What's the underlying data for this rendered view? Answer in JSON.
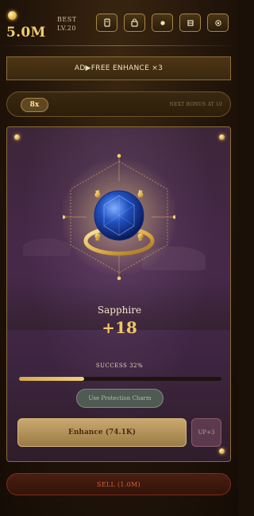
{
  "header": {
    "gold": "5.0M",
    "best_label": "BEST",
    "best_level": "LV.20",
    "toolbar_icons": [
      "card-icon",
      "lock-icon",
      "dot-icon",
      "grid-icon",
      "target-icon"
    ]
  },
  "ad_banner": {
    "label": "AD▶FREE ENHANCE ×3"
  },
  "multiplier": {
    "value": "8x",
    "next_bonus": "NEXT BONUS AT 10"
  },
  "item": {
    "name": "Sapphire",
    "level": "+18",
    "gem_color": "#1f4fb8",
    "setting_color": "#e0b24a"
  },
  "success": {
    "label": "SUCCESS 32%",
    "progress": 0.32
  },
  "buttons": {
    "protection": "Use Protection Charm",
    "enhance": "Enhance (74.1K)",
    "up": "UP+3",
    "sell": "SELL (1.0M)"
  },
  "colors": {
    "accent_gold": "#f0cd72",
    "sell_red": "#d4603e",
    "panel_purple": "#47284a"
  }
}
